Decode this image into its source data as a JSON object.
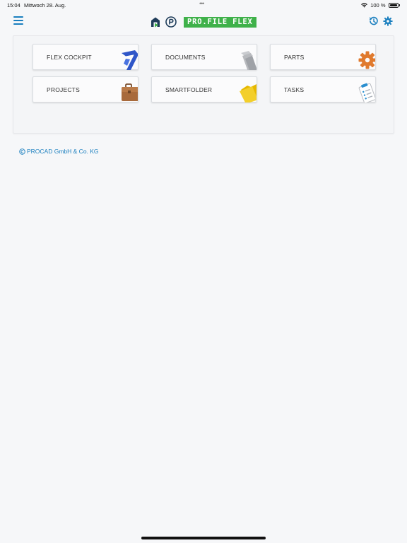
{
  "status_bar": {
    "time": "15:04",
    "date": "Mittwoch 28. Aug.",
    "battery": "100 %"
  },
  "header": {
    "brand": "PRO.FILE FLEX",
    "accent_color": "#1a7fbf",
    "brand_color": "#3fb14a",
    "icons": [
      "menu-icon",
      "profile-logo-icon",
      "procad-p-icon",
      "history-icon",
      "gear-icon"
    ]
  },
  "tiles": [
    {
      "label": "FLEX COCKPIT",
      "icon": "flex-cockpit-icon"
    },
    {
      "label": "DOCUMENTS",
      "icon": "documents-icon"
    },
    {
      "label": "PARTS",
      "icon": "parts-gear-icon"
    },
    {
      "label": "PROJECTS",
      "icon": "briefcase-icon"
    },
    {
      "label": "SMARTFOLDER",
      "icon": "folder-icon"
    },
    {
      "label": "TASKS",
      "icon": "clipboard-icon"
    }
  ],
  "footer": {
    "copyright": "PROCAD GmbH & Co. KG"
  }
}
